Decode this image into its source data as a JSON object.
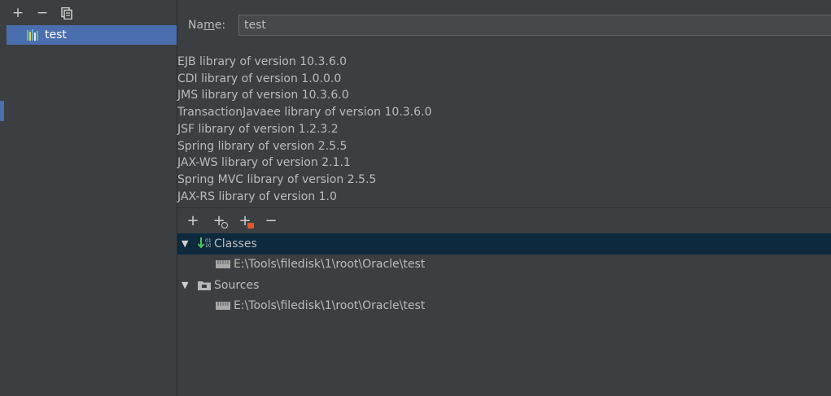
{
  "left_panel": {
    "toolbar": [
      {
        "icon": "plus-icon",
        "glyph": "+"
      },
      {
        "icon": "minus-icon",
        "glyph": "−"
      },
      {
        "icon": "copy-icon",
        "glyph": ""
      }
    ],
    "libraries": [
      {
        "label": "test",
        "icon": "library-icon"
      }
    ],
    "selection_color": "#4b6eaf"
  },
  "details": {
    "name_label_pre": "Na",
    "name_label_mnemonic": "m",
    "name_label_post": "e:",
    "name_value": "test",
    "library_versions": [
      "EJB library of version 10.3.6.0",
      "CDI library of version 1.0.0.0",
      "JMS library of version 10.3.6.0",
      "TransactionJavaee library of version 10.3.6.0",
      "JSF library of version 1.2.3.2",
      "Spring library of version 2.5.5",
      "JAX-WS library of version 2.1.1",
      "Spring MVC library of version 2.5.5",
      "JAX-RS library of version 1.0"
    ],
    "tree_toolbar": [
      {
        "icon": "add-icon",
        "glyph": "+"
      },
      {
        "icon": "add-jar-directory-icon",
        "glyph": "+"
      },
      {
        "icon": "attach-files-icon",
        "glyph": "+"
      },
      {
        "icon": "remove-icon",
        "glyph": "−"
      }
    ],
    "tree": {
      "classes_label": "Classes",
      "classes_path": "E:\\Tools\\filedisk\\1\\root\\Oracle\\test",
      "sources_label": "Sources",
      "sources_path": "E:\\Tools\\filedisk\\1\\root\\Oracle\\test",
      "expanded_glyph": "▼"
    }
  }
}
